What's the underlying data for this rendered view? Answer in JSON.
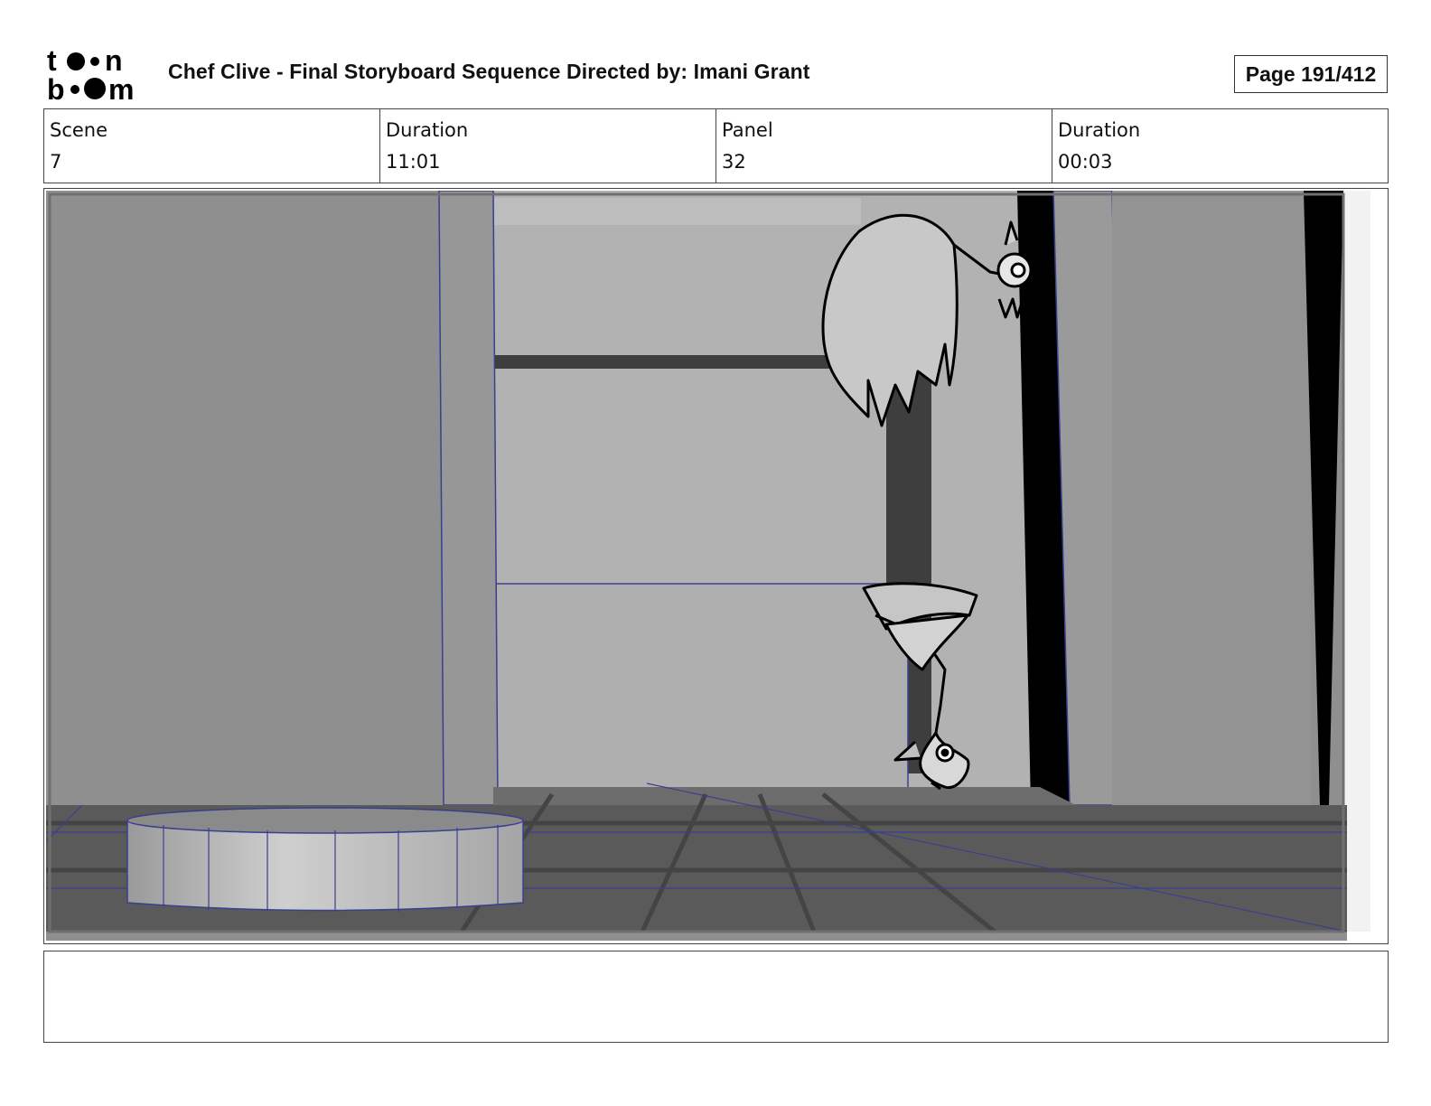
{
  "header": {
    "logo_text_top": "toon",
    "logo_text_bottom": "boom",
    "title": "Chef Clive - Final Storyboard Sequence  Directed by: Imani Grant",
    "page_label": "Page 191/412"
  },
  "info": {
    "scene_label": "Scene",
    "scene_value": "7",
    "duration_label": "Duration",
    "duration_value": "11:01",
    "panel_label": "Panel",
    "panel_value": "32",
    "panel_duration_label": "Duration",
    "panel_duration_value": "00:03"
  },
  "notes": {
    "text": ""
  },
  "colors": {
    "wireframe": "#3a3f8f",
    "wall_dark": "#8f8f8f",
    "wall_light": "#b4b4b4",
    "floor": "#5a5a5a",
    "ink": "#000000"
  }
}
